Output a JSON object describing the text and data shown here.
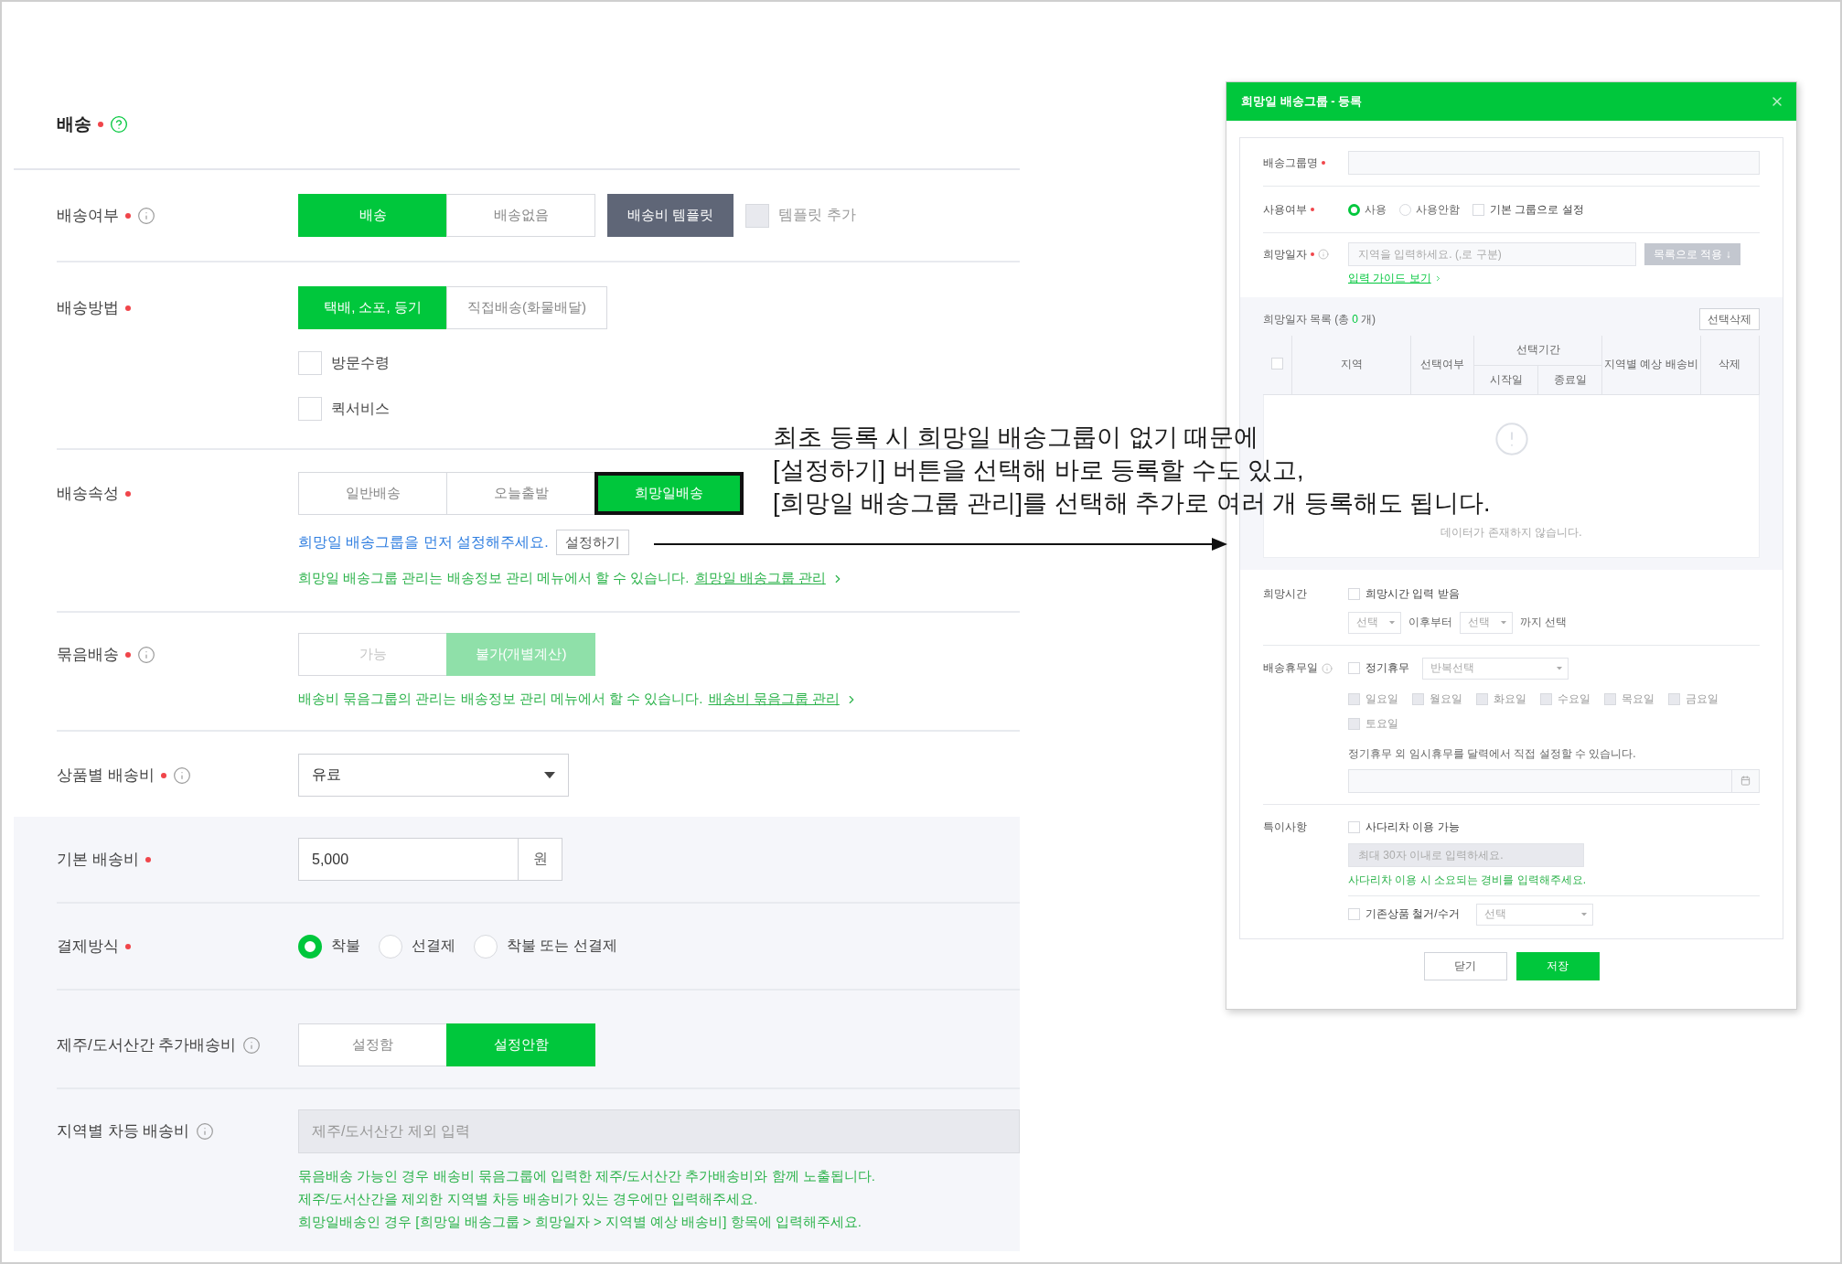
{
  "section": {
    "title": "배송",
    "required": true
  },
  "rows": [
    {
      "kind": "segmented",
      "label": "배송여부",
      "required": true,
      "info": true,
      "disabled": false,
      "options": [
        {
          "label": "배송",
          "selected": true,
          "highlighted": false
        },
        {
          "label": "배송없음",
          "selected": false,
          "highlighted": false
        }
      ],
      "extra_button": "배송비 템플릿",
      "checkboxes": [
        {
          "label": "템플릿 추가",
          "checked": false,
          "disabled": true
        }
      ]
    },
    {
      "kind": "segmented",
      "label": "배송방법",
      "required": true,
      "info": false,
      "disabled": false,
      "options": [
        {
          "label": "택배, 소포, 등기",
          "selected": true,
          "highlighted": false
        },
        {
          "label": "직접배송(화물배달)",
          "selected": false,
          "highlighted": false
        }
      ],
      "stacked_checkboxes": [
        {
          "label": "방문수령",
          "checked": false,
          "disabled": false
        },
        {
          "label": "퀵서비스",
          "checked": false,
          "disabled": false
        }
      ]
    },
    {
      "kind": "segmented",
      "label": "배송속성",
      "required": true,
      "info": false,
      "disabled": false,
      "options": [
        {
          "label": "일반배송",
          "selected": false,
          "highlighted": false
        },
        {
          "label": "오늘출발",
          "selected": false,
          "highlighted": false
        },
        {
          "label": "희망일배송",
          "selected": true,
          "highlighted": true
        }
      ],
      "notice": {
        "text": "희망일 배송그룹을 먼저 설정해주세요.",
        "button": "설정하기"
      },
      "notes": [
        {
          "text": "희망일 배송그룹 관리는 배송정보 관리 메뉴에서 할 수 있습니다.",
          "link": "희망일 배송그룹 관리"
        }
      ]
    },
    {
      "kind": "segmented",
      "label": "묶음배송",
      "required": true,
      "info": true,
      "disabled": true,
      "options": [
        {
          "label": "가능",
          "selected": false,
          "highlighted": false
        },
        {
          "label": "불가(개별계산)",
          "selected": true,
          "highlighted": false
        }
      ],
      "notes": [
        {
          "text": "배송비 묶음그룹의 관리는 배송정보 관리 메뉴에서 할 수 있습니다.",
          "link": "배송비 묶음그룹 관리"
        }
      ]
    },
    {
      "kind": "select",
      "label": "상품별 배송비",
      "required": true,
      "info": true,
      "value": "유료"
    }
  ],
  "fee_panel": {
    "rows": [
      {
        "kind": "amount",
        "label": "기본 배송비",
        "required": true,
        "info": false,
        "value": "5,000",
        "unit": "원"
      },
      {
        "kind": "radio",
        "label": "결제방식",
        "required": true,
        "info": false,
        "options": [
          {
            "label": "착불",
            "selected": true
          },
          {
            "label": "선결제",
            "selected": false
          },
          {
            "label": "착불 또는 선결제",
            "selected": false
          }
        ]
      },
      {
        "kind": "segmented",
        "label": "제주/도서산간 추가배송비",
        "required": false,
        "info": true,
        "disabled": false,
        "options": [
          {
            "label": "설정함",
            "selected": false,
            "highlighted": false
          },
          {
            "label": "설정안함",
            "selected": true,
            "highlighted": false
          }
        ]
      },
      {
        "kind": "text",
        "label": "지역별 차등 배송비",
        "required": false,
        "info": true,
        "placeholder": "제주/도서산간 제외 입력",
        "notes": [
          {
            "text": "묶음배송 가능인 경우 배송비 묶음그룹에 입력한 제주/도서산간 추가배송비와 함께 노출됩니다."
          },
          {
            "text": "제주/도서산간을 제외한 지역별 차등 배송비가 있는 경우에만 입력해주세요."
          },
          {
            "text": "희망일배송인 경우 [희망일 배송그룹 > 희망일자 > 지역별 예상 배송비] 항목에 입력해주세요."
          }
        ]
      }
    ]
  },
  "annotation": [
    "최초 등록 시 희망일 배송그룹이 없기 때문에",
    "[설정하기] 버튼을 선택해 바로 등록할 수도 있고,",
    "[희망일 배송그룹 관리]를 선택해 추가로 여러 개 등록해도 됩니다."
  ],
  "dialog": {
    "title": "희망일 배송그룹 - 등록",
    "group_name": {
      "label": "배송그룹명",
      "required": true
    },
    "usage": {
      "label": "사용여부",
      "required": true,
      "options": [
        {
          "label": "사용",
          "selected": true
        },
        {
          "label": "사용안함",
          "selected": false
        }
      ],
      "default_group": {
        "label": "기본 그룹으로 설정",
        "checked": false
      }
    },
    "dates": {
      "label": "희망일자",
      "required": true,
      "info": true,
      "placeholder": "지역을 입력하세요. (,로 구분)",
      "apply_button": "목록으로 적용 ↓",
      "guide_link": "입력 가이드 보기"
    },
    "date_list": {
      "select_all": {
        "checked": false
      },
      "title": "희망일자 목록",
      "count_before": "(총",
      "count": "0",
      "count_after": "개)",
      "delete_button": "선택삭제",
      "columns": [
        "지역",
        "선택여부",
        "지역별 예상 배송비",
        "삭제"
      ],
      "group_header": "선택기간",
      "sub_columns": [
        "시작일",
        "종료일"
      ],
      "empty": "데이터가 존재하지 않습니다."
    },
    "time": {
      "label": "희망시간",
      "checkbox": {
        "label": "희망시간 입력 받음",
        "checked": false
      },
      "from": "선택",
      "from_suffix": "이후부터",
      "to": "선택",
      "to_suffix": "까지 선택"
    },
    "holidays": {
      "label": "배송휴무일",
      "info": true,
      "checkbox": {
        "label": "정기휴무",
        "checked": false
      },
      "select": "반복선택",
      "days": [
        {
          "label": "일요일",
          "checked": false,
          "disabled": true
        },
        {
          "label": "월요일",
          "checked": false,
          "disabled": true
        },
        {
          "label": "화요일",
          "checked": false,
          "disabled": true
        },
        {
          "label": "수요일",
          "checked": false,
          "disabled": true
        },
        {
          "label": "목요일",
          "checked": false,
          "disabled": true
        },
        {
          "label": "금요일",
          "checked": false,
          "disabled": true
        },
        {
          "label": "토요일",
          "checked": false,
          "disabled": true
        }
      ],
      "hint": "정기휴무 외 임시휴무를 달력에서 직접 설정할 수 있습니다."
    },
    "special": {
      "label": "특이사항",
      "ladder": {
        "label": "사다리차 이용 가능",
        "checked": false
      },
      "placeholder": "최대 30자 이내로 입력하세요.",
      "note": "사다리차 이용 시 소요되는 경비를 입력해주세요.",
      "removal": {
        "label": "기존상품 철거/수거",
        "checked": false
      },
      "removal_select": "선택"
    },
    "buttons": [
      {
        "label": "닫기",
        "kind": "secondary"
      },
      {
        "label": "저장",
        "kind": "primary"
      }
    ]
  }
}
